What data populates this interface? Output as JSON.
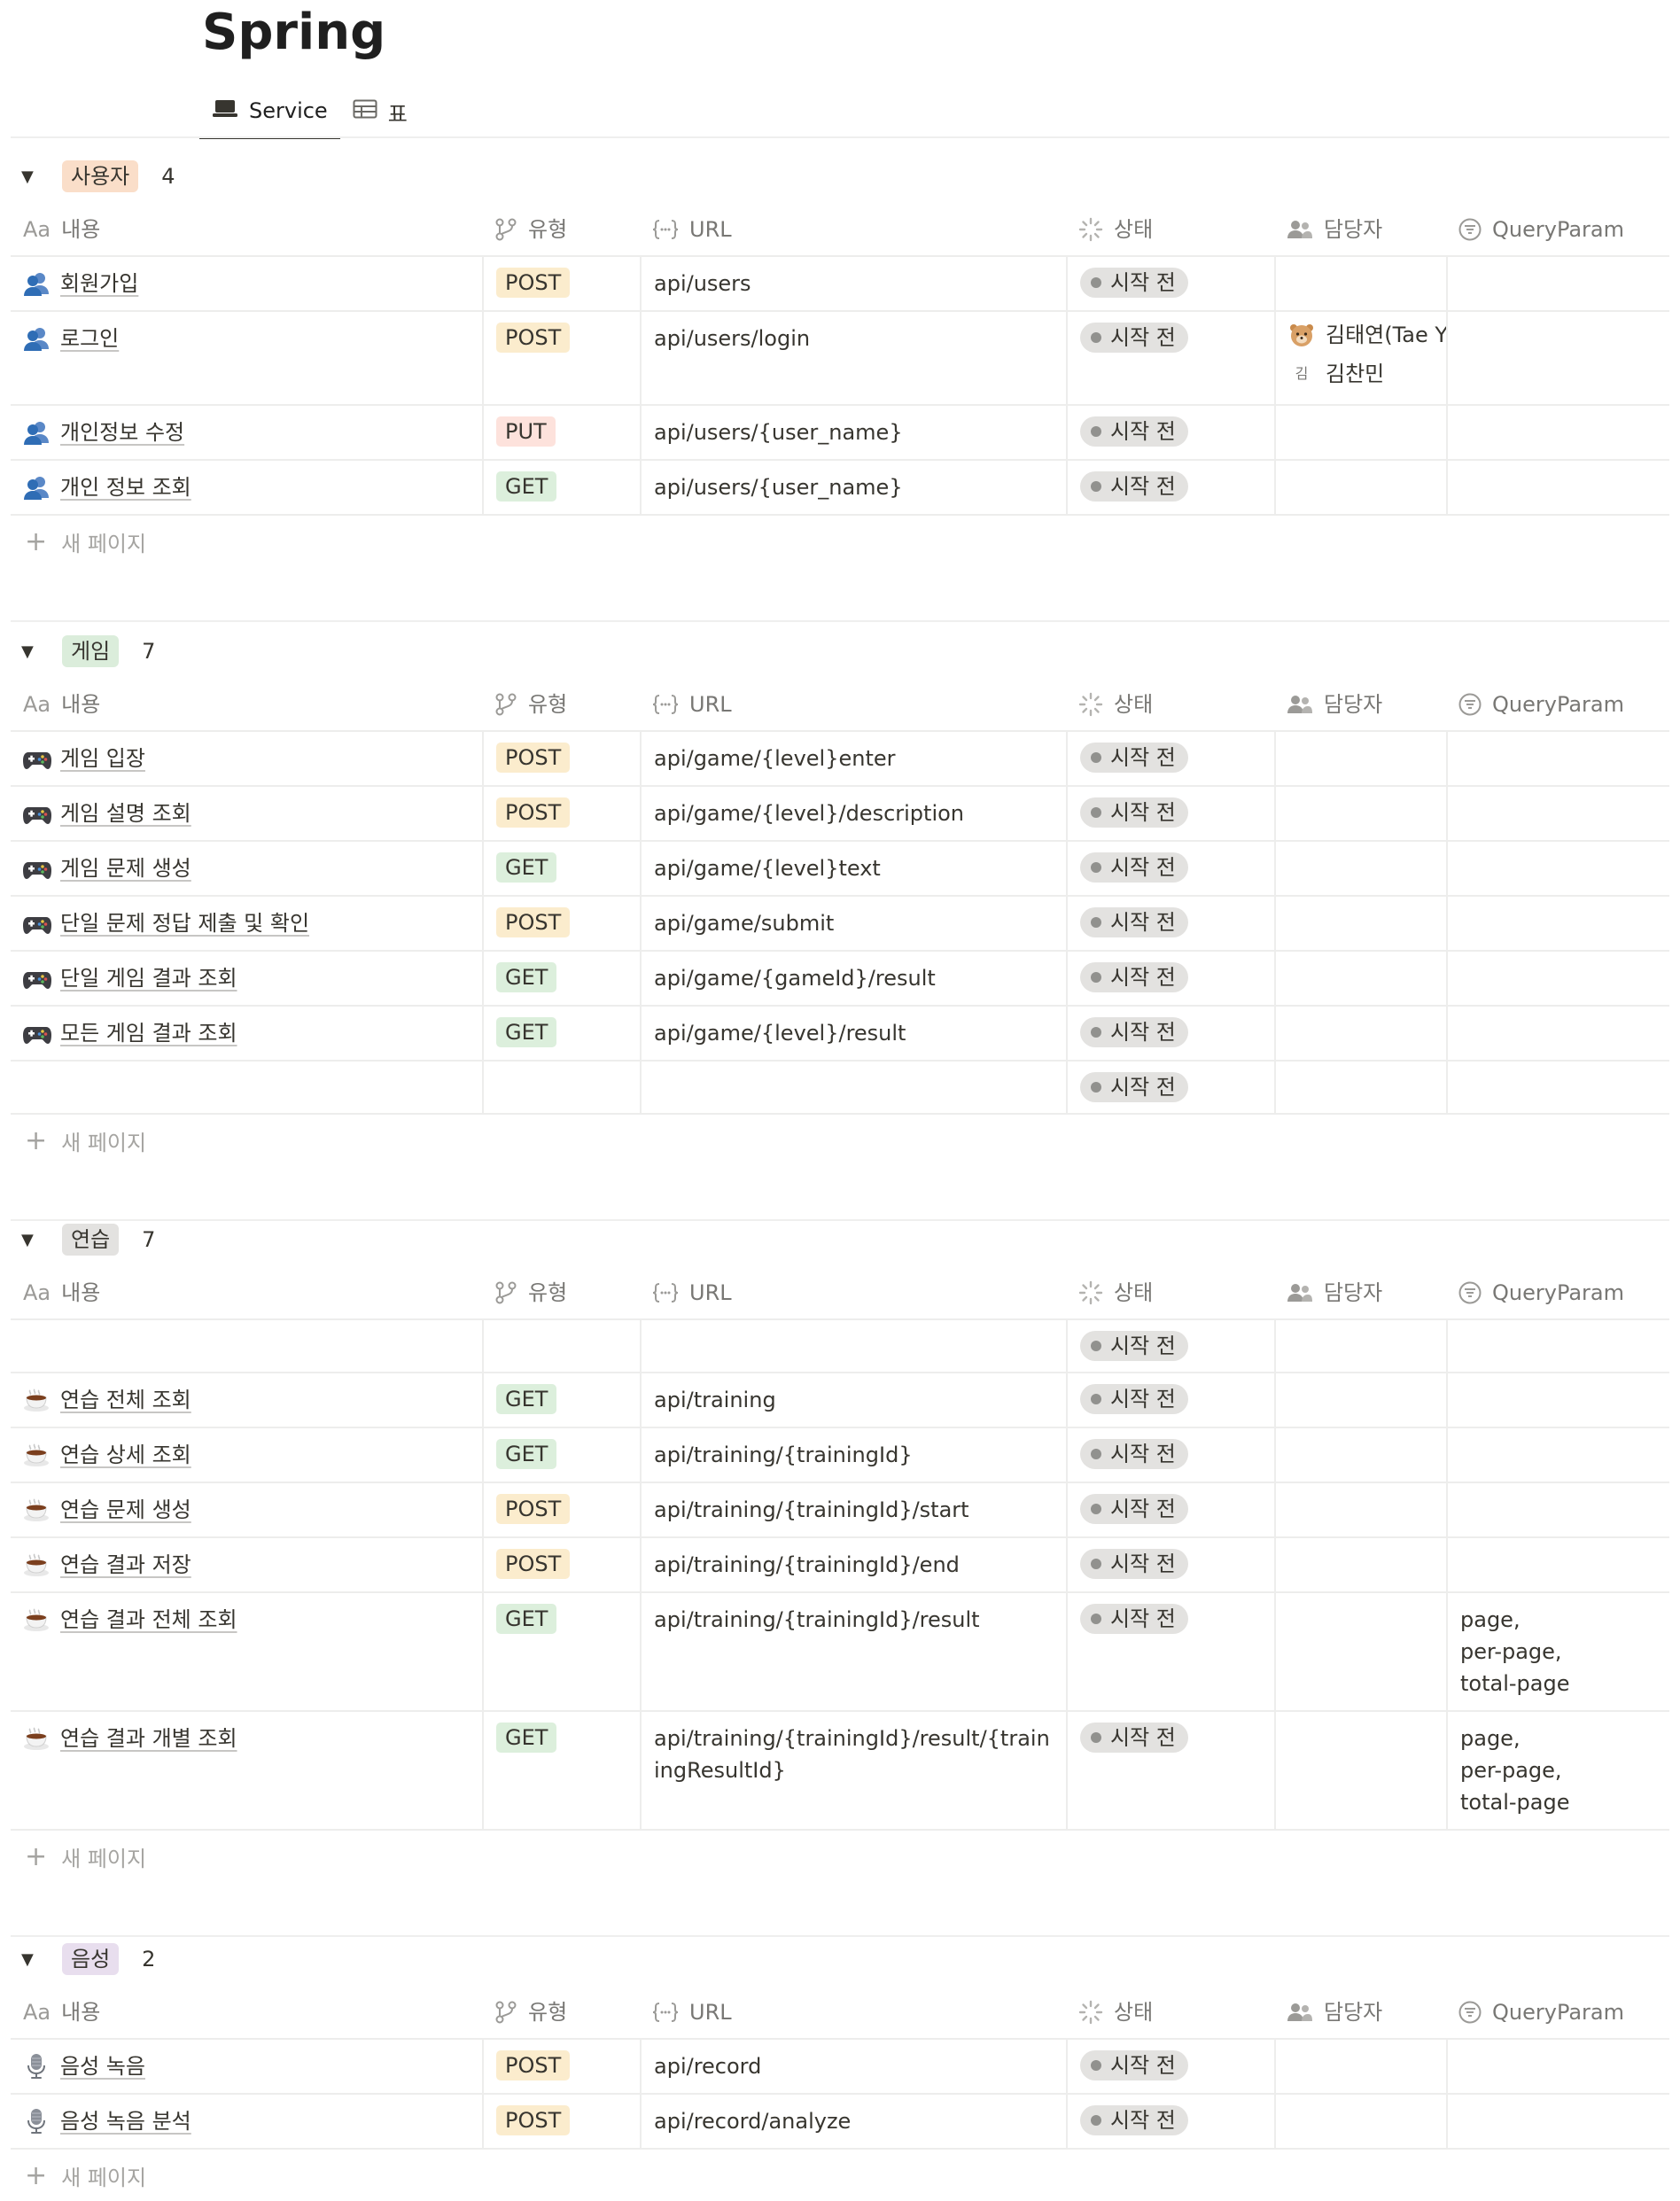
{
  "page": {
    "title": "Spring"
  },
  "views": [
    {
      "label": "Service",
      "icon": "laptop-icon",
      "active": true
    },
    {
      "label": "표",
      "icon": "table-icon",
      "active": false
    }
  ],
  "columns": {
    "name": "내용",
    "name_prefix": "Aa",
    "type": "유형",
    "url": "URL",
    "status": "상태",
    "assignee": "담당자",
    "query": "QueryParam"
  },
  "new_page_label": "새 페이지",
  "status_default": "시작 전",
  "groups": [
    {
      "label": "사용자",
      "count": "4",
      "tag_color": "#fadec9",
      "emoji": "users-icon",
      "rows": [
        {
          "name": "회원가입",
          "method": "POST",
          "url": "api/users",
          "status": "시작 전",
          "assignees": [],
          "query": ""
        },
        {
          "name": "로그인",
          "method": "POST",
          "url": "api/users/login",
          "status": "시작 전",
          "assignees": [
            {
              "name": "김태연(Tae Y",
              "avatar": "bear-avatar"
            },
            {
              "name": "김찬민",
              "avatar": "initial-avatar",
              "initial": "김"
            }
          ],
          "query": ""
        },
        {
          "name": "개인정보 수정",
          "method": "PUT",
          "url": "api/users/{user_name}",
          "status": "시작 전",
          "assignees": [],
          "query": ""
        },
        {
          "name": "개인 정보 조회",
          "method": "GET",
          "url": "api/users/{user_name}",
          "status": "시작 전",
          "assignees": [],
          "query": ""
        }
      ]
    },
    {
      "label": "게임",
      "count": "7",
      "tag_color": "#dbeddb",
      "emoji": "gamepad-icon",
      "rows": [
        {
          "name": "게임 입장",
          "method": "POST",
          "url": "api/game/{level}enter",
          "status": "시작 전",
          "assignees": [],
          "query": ""
        },
        {
          "name": "게임 설명 조회",
          "method": "POST",
          "url": "api/game/{level}/description",
          "status": "시작 전",
          "assignees": [],
          "query": ""
        },
        {
          "name": "게임 문제 생성",
          "method": "GET",
          "url": "api/game/{level}text",
          "status": "시작 전",
          "assignees": [],
          "query": ""
        },
        {
          "name": "단일 문제 정답 제출 및 확인",
          "method": "POST",
          "url": "api/game/submit",
          "status": "시작 전",
          "assignees": [],
          "query": ""
        },
        {
          "name": "단일 게임 결과 조회",
          "method": "GET",
          "url": "api/game/{gameId}/result",
          "status": "시작 전",
          "assignees": [],
          "query": ""
        },
        {
          "name": "모든 게임 결과 조회",
          "method": "GET",
          "url": "api/game/{level}/result",
          "status": "시작 전",
          "assignees": [],
          "query": ""
        },
        {
          "name": "",
          "method": "",
          "url": "",
          "status": "시작 전",
          "assignees": [],
          "query": ""
        }
      ]
    },
    {
      "label": "연습",
      "count": "7",
      "tag_color": "#e3e2e0",
      "emoji": "coffee-icon",
      "rows": [
        {
          "name": "",
          "method": "",
          "url": "",
          "status": "시작 전",
          "assignees": [],
          "query": ""
        },
        {
          "name": "연습 전체 조회",
          "method": "GET",
          "url": "api/training",
          "status": "시작 전",
          "assignees": [],
          "query": ""
        },
        {
          "name": "연습 상세 조회",
          "method": "GET",
          "url": "api/training/{trainingId}",
          "status": "시작 전",
          "assignees": [],
          "query": ""
        },
        {
          "name": "연습 문제 생성",
          "method": "POST",
          "url": "api/training/{trainingId}/start",
          "status": "시작 전",
          "assignees": [],
          "query": ""
        },
        {
          "name": "연습 결과 저장",
          "method": "POST",
          "url": "api/training/{trainingId}/end",
          "status": "시작 전",
          "assignees": [],
          "query": ""
        },
        {
          "name": "연습 결과 전체 조회",
          "method": "GET",
          "url": "api/training/{trainingId}/result",
          "status": "시작 전",
          "assignees": [],
          "query": "page,\nper-page,\ntotal-page"
        },
        {
          "name": "연습 결과 개별 조회",
          "method": "GET",
          "url": "api/training/{trainingId}/result/{trainingResultId}",
          "status": "시작 전",
          "assignees": [],
          "query": "page,\nper-page,\ntotal-page"
        }
      ]
    },
    {
      "label": "음성",
      "count": "2",
      "tag_color": "#e8deee",
      "emoji": "microphone-icon",
      "rows": [
        {
          "name": "음성 녹음",
          "method": "POST",
          "url": "api/record",
          "status": "시작 전",
          "assignees": [],
          "query": ""
        },
        {
          "name": "음성 녹음 분석",
          "method": "POST",
          "url": "api/record/analyze",
          "status": "시작 전",
          "assignees": [],
          "query": ""
        }
      ]
    }
  ]
}
